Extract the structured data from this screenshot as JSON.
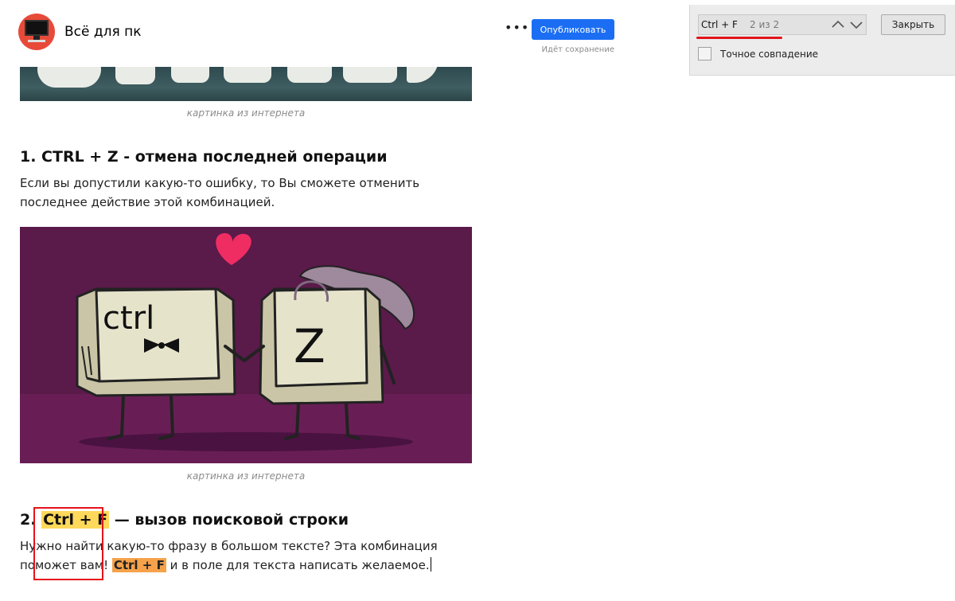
{
  "header": {
    "channel_name": "Всё для пк",
    "more_label": "•••",
    "publish_label": "Опубликовать",
    "save_status": "Идёт сохранение"
  },
  "article": {
    "caption_1": "картинка из интернета",
    "heading_1": "1. CTRL + Z -  отмена последней операции",
    "paragraph_1": "Если вы допустили какую-то ошибку, то Вы сможете отменить последнее действие этой комбинацией.",
    "image_keys": {
      "key_left": "ctrl",
      "key_right": "Z"
    },
    "caption_2": "картинка из интернета",
    "heading_2": {
      "prefix": "2. ",
      "match": "Ctrl + F",
      "suffix": " — вызов поисковой строки"
    },
    "paragraph_2": {
      "part_1": "Нужно найти какую-то фразу в большом тексте? Эта комбинация поможет вам!  ",
      "match": "Ctrl + F",
      "part_2": " и в поле для текста написать желаемое."
    }
  },
  "find_bar": {
    "query": "Ctrl + F",
    "match_count": "2 из 2",
    "prev_icon": "chevron-up-icon",
    "next_icon": "chevron-down-icon",
    "close_label": "Закрыть",
    "exact_match_label": "Точное совпадение",
    "exact_match_checked": false
  },
  "colors": {
    "publish_button": "#1b6ef3",
    "highlight_match": "#ffd95a",
    "highlight_current": "#f5a24b",
    "annotation_red": "#e5141a",
    "image_background": "#5a1a4a"
  }
}
